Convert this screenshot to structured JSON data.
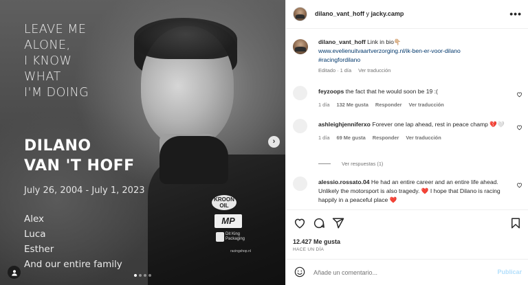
{
  "photo": {
    "quote_lines": [
      "LEAVE ME",
      "ALONE,",
      "I KNOW",
      "WHAT",
      "I'M DOING"
    ],
    "name_lines": [
      "DILANO",
      "VAN 'T HOFF"
    ],
    "dates": "July 26, 2004  -  July 1, 2023",
    "family_lines": [
      "Alex",
      "Luca",
      "Esther",
      "And our entire family"
    ],
    "sponsors": {
      "kroon": "KROON OIL",
      "mp": "MP",
      "dk": "Dit King Packaging",
      "site": "racingshop.nl"
    },
    "carousel": {
      "total": 4,
      "active_index": 0
    }
  },
  "header": {
    "user": "dilano_vant_hoff",
    "joiner": " y ",
    "collab": "jacky.camp",
    "more_icon": "more-horizontal-icon"
  },
  "caption": {
    "user": "dilano_vant_hoff",
    "text": "Link in bio👇🏼",
    "link": "www.evelienuitvaartverzorging.nl/ik-ben-er-voor-dilano",
    "hashtag": "#racingfordilano",
    "edited": "Editado · 1 día",
    "translate": "Ver traducción"
  },
  "comments": [
    {
      "user": "feyzoops",
      "text": "the fact that he would soon be 19 :(",
      "time": "1 día",
      "likes": "132 Me gusta",
      "reply": "Responder",
      "translate": "Ver traducción"
    },
    {
      "user": "ashleighjenniferxo",
      "text": "Forever one lap ahead, rest in peace champ 💔🤍",
      "time": "1 día",
      "likes": "69 Me gusta",
      "reply": "Responder",
      "translate": "Ver traducción"
    },
    {
      "user": "alessio.rossato.04",
      "text": "He had an entire career and an entire life ahead. Unlikely the motorsport is also tragedy. ❤️ I hope that Dilano is racing happily in a peaceful place ❤️"
    }
  ],
  "view_replies": "Ver respuestas (1)",
  "likes_count": "12.427 Me gusta",
  "posted_ago": "HACE UN DÍA",
  "composer": {
    "placeholder": "Añade un comentario...",
    "publish": "Publicar"
  },
  "colors": {
    "link": "#00376b",
    "muted": "#737373",
    "heart_red": "#ed4956",
    "publish_disabled": "#b2dffc"
  }
}
